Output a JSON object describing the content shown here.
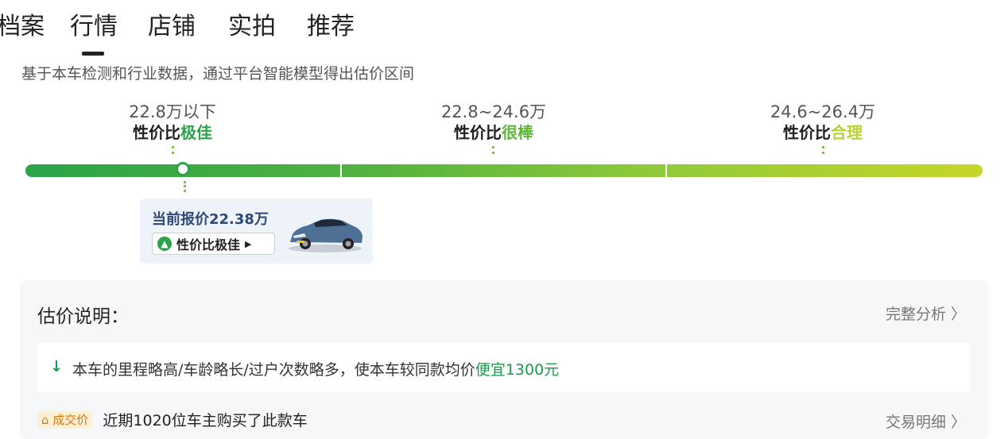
{
  "tabs": [
    "档案",
    "行情",
    "店铺",
    "实拍",
    "推荐"
  ],
  "active_tab": "行情",
  "subtitle": "基于本车检测和行业数据，通过平台智能模型得出估价区间",
  "ranges": [
    {
      "price": "22.8万以下",
      "rating_prefix": "性价比",
      "rating": "极佳",
      "color": "#2aa34a"
    },
    {
      "price": "22.8~24.6万",
      "rating_prefix": "性价比",
      "rating": "很棒",
      "color": "#5fb63a"
    },
    {
      "price": "24.6~26.4万",
      "rating_prefix": "性价比",
      "rating": "合理",
      "color": "#b9d12a"
    }
  ],
  "current_price": {
    "label": "当前报价22.38万",
    "badge": "性价比极佳",
    "value": 22.38
  },
  "explanation": {
    "title": "估价说明：",
    "full_analysis": "完整分析 〉",
    "note_text": "本车的里程略高/车龄略长/过户次数略多，使本车较同款均价",
    "note_highlight": "便宜1300元",
    "deal_tag": "成交价",
    "deal_text": "近期1020位车主购买了此款车",
    "deal_link": "交易明细 〉"
  }
}
